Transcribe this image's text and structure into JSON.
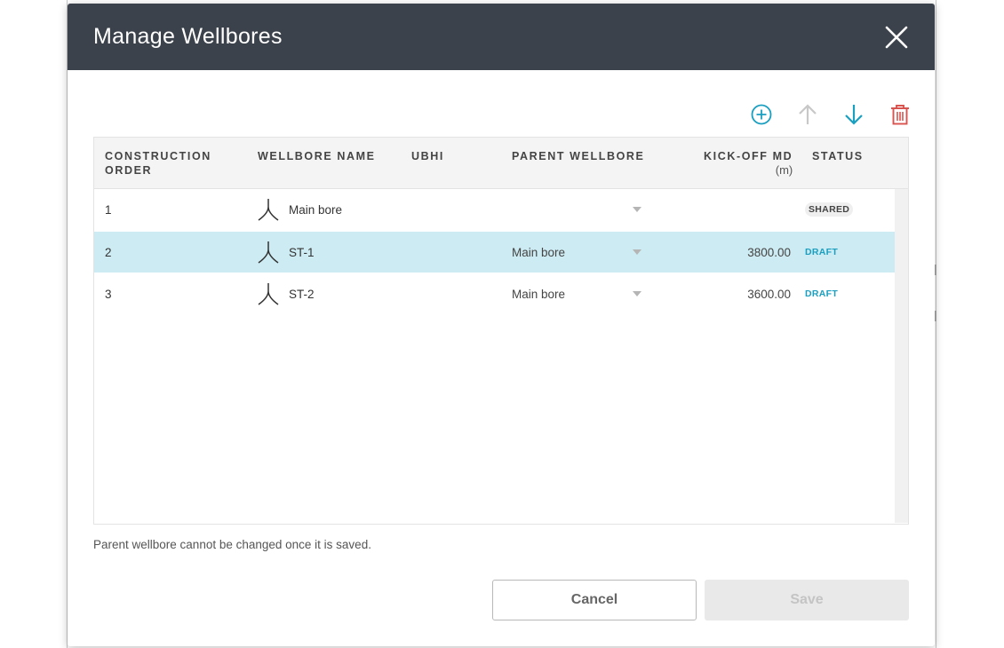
{
  "dialog": {
    "title": "Manage Wellbores",
    "close_icon": "close-icon"
  },
  "toolbar": {
    "add_icon": "add-circle-icon",
    "move_up_icon": "arrow-up-icon",
    "move_down_icon": "arrow-down-icon",
    "delete_icon": "trash-icon"
  },
  "table": {
    "columns": {
      "order": "CONSTRUCTION ORDER",
      "name": "WELLBORE NAME",
      "ubhi": "UBHI",
      "parent": "PARENT WELLBORE",
      "kickoff": "KICK-OFF MD",
      "kickoff_unit": "(m)",
      "status": "STATUS"
    },
    "rows": [
      {
        "order": "1",
        "name": "Main bore",
        "ubhi": "",
        "parent": "",
        "kickoff": "",
        "status": "SHARED"
      },
      {
        "order": "2",
        "name": "ST-1",
        "ubhi": "",
        "parent": "Main bore",
        "kickoff": "3800.00",
        "status": "DRAFT"
      },
      {
        "order": "3",
        "name": "ST-2",
        "ubhi": "",
        "parent": "Main bore",
        "kickoff": "3600.00",
        "status": "DRAFT"
      }
    ],
    "selected_row_index": 1
  },
  "note": "Parent wellbore cannot be changed once it is saved.",
  "buttons": {
    "cancel": "Cancel",
    "save": "Save"
  },
  "colors": {
    "header_bg": "#3b424b",
    "accent": "#1a9fc0",
    "delete": "#d9534f",
    "selected_row": "#cdebf2"
  }
}
